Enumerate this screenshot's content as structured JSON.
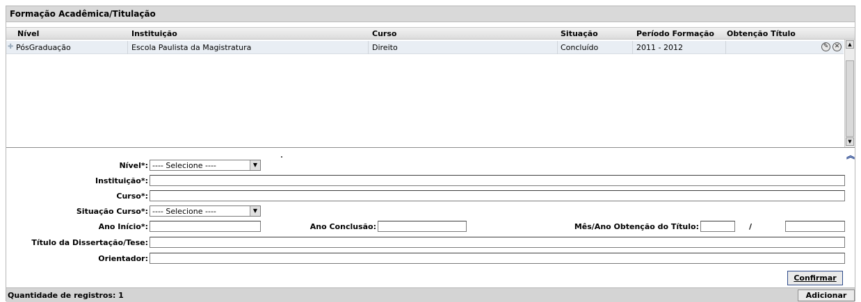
{
  "panel": {
    "title": "Formação Acadêmica/Titulação"
  },
  "grid": {
    "headers": {
      "nivel": "Nível",
      "instituicao": "Instituição",
      "curso": "Curso",
      "situacao": "Situação",
      "periodo": "Período Formação",
      "obtencao": "Obtenção Título"
    },
    "rows": [
      {
        "nivel": "PósGraduação",
        "instituicao": "Escola Paulista da Magistratura",
        "curso": "Direito",
        "situacao": "Concluído",
        "periodo": "2011 - 2012",
        "obtencao": ""
      }
    ],
    "row_actions": [
      "edit-icon",
      "delete-icon"
    ]
  },
  "form": {
    "nivel_label": "Nível*:",
    "nivel_value": "---- Selecione ----",
    "instituicao_label": "Instituição*:",
    "curso_label": "Curso*:",
    "situacao_label": "Situação Curso*:",
    "situacao_value": "---- Selecione ----",
    "ano_inicio_label": "Ano Início*:",
    "ano_conclusao_label": "Ano Conclusão:",
    "mes_ano_label": "Mês/Ano Obtenção do Título:",
    "mes_ano_sep": "/",
    "titulo_label": "Título da Dissertação/Tese:",
    "orientador_label": "Orientador:",
    "confirm_label": "Confirmar"
  },
  "footer": {
    "count_label": "Quantidade de registros: 1",
    "add_label": "Adicionar"
  },
  "colors": {
    "header_bg": "#d9d9d9",
    "row_bg": "#e9eef4",
    "accent": "#1f3f8a"
  }
}
